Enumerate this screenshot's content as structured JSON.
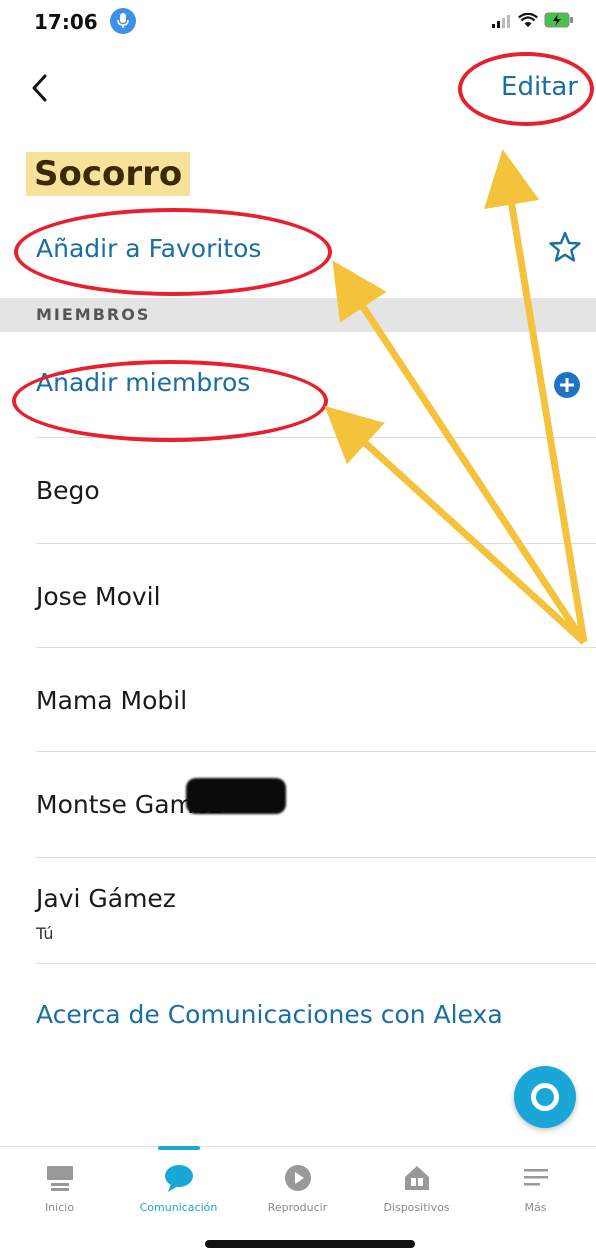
{
  "status_bar": {
    "time": "17:06"
  },
  "nav": {
    "edit_label": "Editar"
  },
  "title": "Socorro",
  "favorites": {
    "label": "Añadir a Favoritos"
  },
  "members_section": {
    "header": "MIEMBROS",
    "add_label": "Añadir miembros"
  },
  "members": [
    {
      "name": "Bego",
      "sub": ""
    },
    {
      "name": "Jose Movil",
      "sub": ""
    },
    {
      "name": "Mama Mobil",
      "sub": ""
    },
    {
      "name": "Montse Gamez",
      "sub": ""
    },
    {
      "name": "Javi Gámez",
      "sub": "Tú"
    }
  ],
  "about_link": "Acerca de Comunicaciones con Alexa",
  "tabs": [
    {
      "label": "Inicio",
      "icon": "home-tv-icon"
    },
    {
      "label": "Comunicación",
      "icon": "chat-bubble-icon",
      "active": true
    },
    {
      "label": "Reproducir",
      "icon": "play-icon"
    },
    {
      "label": "Dispositivos",
      "icon": "devices-house-icon"
    },
    {
      "label": "Más",
      "icon": "menu-lines-icon"
    }
  ],
  "colors": {
    "link_blue": "#1a6ea3",
    "accent_cyan": "#1aa6d6",
    "annotation_red": "#e8202e",
    "annotation_yellow": "#f5c23b",
    "title_highlight": "#f7e29c"
  }
}
